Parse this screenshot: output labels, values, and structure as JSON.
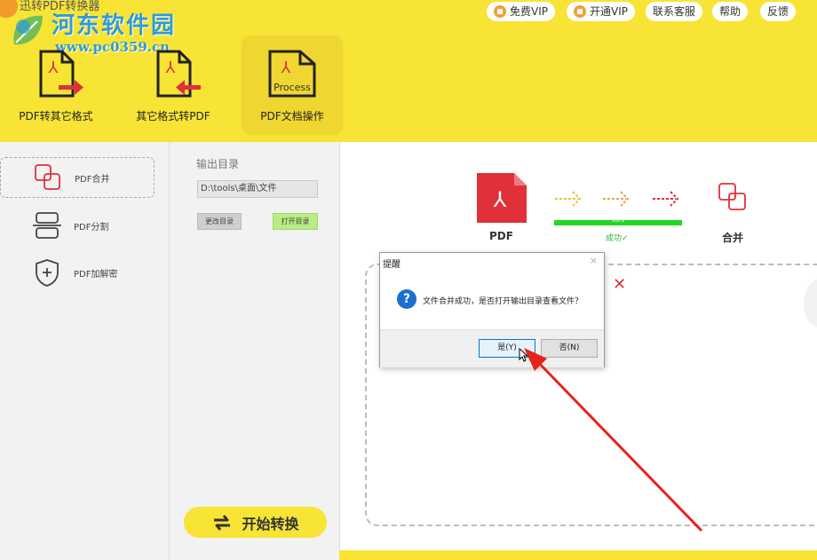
{
  "app": {
    "title": "迅转PDF转换器"
  },
  "watermark": {
    "name": "河东软件园",
    "url": "www.pc0359.cn"
  },
  "top_buttons": [
    {
      "label": "免费VIP",
      "icon": "vip-icon"
    },
    {
      "label": "开通VIP",
      "icon": "vip-icon"
    },
    {
      "label": "联系客服"
    },
    {
      "label": "帮助"
    },
    {
      "label": "反馈"
    }
  ],
  "tools": [
    {
      "label": "PDF转其它格式"
    },
    {
      "label": "其它格式转PDF"
    },
    {
      "label": "PDF文档操作",
      "badge": "Process",
      "active": true
    }
  ],
  "sidebar": {
    "items": [
      {
        "label": "PDF合并",
        "active": true
      },
      {
        "label": "PDF分割"
      },
      {
        "label": "PDF加解密"
      }
    ]
  },
  "output": {
    "label": "输出目录",
    "path": "D:\\tools\\桌面\\文件",
    "change_button": "更改目录",
    "open_button": "打开目录"
  },
  "start_button": {
    "label": "开始转换"
  },
  "flow": {
    "source_label": "PDF",
    "target_label": "合并",
    "progress": 1.0,
    "progress_text": "100%",
    "status": "成功✓"
  },
  "dialog": {
    "title": "提醒",
    "message": "文件合并成功，是否打开输出目录查看文件？",
    "yes_label": "是(Y)",
    "no_label": "否(N)",
    "close_glyph": "×"
  },
  "colors": {
    "brand_yellow": "#f7e435",
    "accent_red": "#e0303a",
    "success_green": "#22d722"
  }
}
